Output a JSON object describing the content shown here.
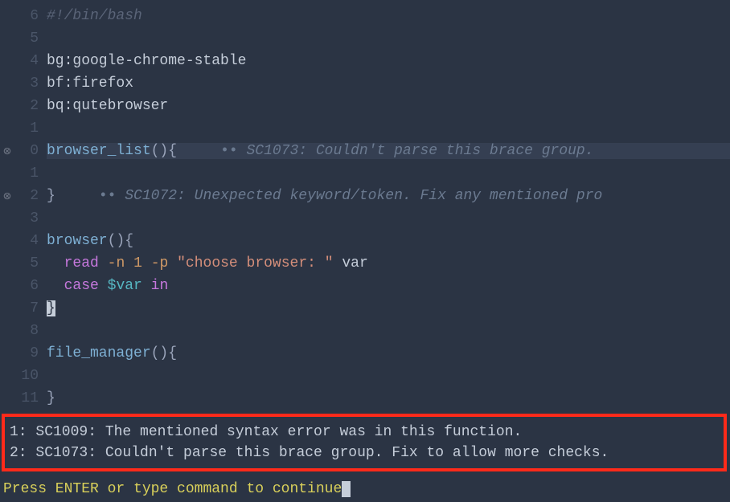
{
  "lines": [
    {
      "rel": "6",
      "sign": "",
      "hl": false,
      "segments": [
        {
          "cls": "comment",
          "text": "#!/bin/bash"
        }
      ]
    },
    {
      "rel": "5",
      "sign": "",
      "hl": false,
      "segments": []
    },
    {
      "rel": "4",
      "sign": "",
      "hl": false,
      "segments": [
        {
          "cls": "plain",
          "text": "bg:google-chrome-stable"
        }
      ]
    },
    {
      "rel": "3",
      "sign": "",
      "hl": false,
      "segments": [
        {
          "cls": "plain",
          "text": "bf:firefox"
        }
      ]
    },
    {
      "rel": "2",
      "sign": "",
      "hl": false,
      "segments": [
        {
          "cls": "plain",
          "text": "bq:qutebrowser"
        }
      ]
    },
    {
      "rel": "1",
      "sign": "",
      "hl": false,
      "segments": []
    },
    {
      "rel": "0",
      "sign": "⊗",
      "hl": true,
      "segments": [
        {
          "cls": "func",
          "text": "browser_list"
        },
        {
          "cls": "paren",
          "text": "()"
        },
        {
          "cls": "brace",
          "text": "{"
        },
        {
          "cls": "plain",
          "text": "     "
        },
        {
          "cls": "lint-dots",
          "text": "•• "
        },
        {
          "cls": "lint-msg",
          "text": "SC1073: Couldn't parse this brace group."
        }
      ]
    },
    {
      "rel": "1",
      "sign": "",
      "hl": false,
      "segments": []
    },
    {
      "rel": "2",
      "sign": "⊗",
      "hl": false,
      "segments": [
        {
          "cls": "brace",
          "text": "}"
        },
        {
          "cls": "plain",
          "text": "     "
        },
        {
          "cls": "lint-dots",
          "text": "•• "
        },
        {
          "cls": "lint-msg",
          "text": "SC1072: Unexpected keyword/token. Fix any mentioned pro"
        }
      ]
    },
    {
      "rel": "3",
      "sign": "",
      "hl": false,
      "segments": []
    },
    {
      "rel": "4",
      "sign": "",
      "hl": false,
      "segments": [
        {
          "cls": "func",
          "text": "browser"
        },
        {
          "cls": "paren",
          "text": "()"
        },
        {
          "cls": "brace",
          "text": "{"
        }
      ]
    },
    {
      "rel": "5",
      "sign": "",
      "hl": false,
      "segments": [
        {
          "cls": "plain",
          "text": "  "
        },
        {
          "cls": "keyword",
          "text": "read"
        },
        {
          "cls": "plain",
          "text": " "
        },
        {
          "cls": "flag",
          "text": "-n"
        },
        {
          "cls": "plain",
          "text": " "
        },
        {
          "cls": "number",
          "text": "1"
        },
        {
          "cls": "plain",
          "text": " "
        },
        {
          "cls": "flag",
          "text": "-p"
        },
        {
          "cls": "plain",
          "text": " "
        },
        {
          "cls": "string",
          "text": "\"choose browser: \""
        },
        {
          "cls": "plain",
          "text": " var"
        }
      ]
    },
    {
      "rel": "6",
      "sign": "",
      "hl": false,
      "segments": [
        {
          "cls": "plain",
          "text": "  "
        },
        {
          "cls": "keyword",
          "text": "case"
        },
        {
          "cls": "plain",
          "text": " "
        },
        {
          "cls": "var",
          "text": "$var"
        },
        {
          "cls": "plain",
          "text": " "
        },
        {
          "cls": "keyword",
          "text": "in"
        }
      ]
    },
    {
      "rel": "7",
      "sign": "",
      "hl": false,
      "segments": [
        {
          "cls": "cursor-block",
          "text": "}"
        }
      ]
    },
    {
      "rel": "8",
      "sign": "",
      "hl": false,
      "segments": []
    },
    {
      "rel": "9",
      "sign": "",
      "hl": false,
      "segments": [
        {
          "cls": "func",
          "text": "file_manager"
        },
        {
          "cls": "paren",
          "text": "()"
        },
        {
          "cls": "brace",
          "text": "{"
        }
      ]
    },
    {
      "rel": "10",
      "sign": "",
      "hl": false,
      "segments": []
    },
    {
      "rel": "11",
      "sign": "",
      "hl": false,
      "segments": [
        {
          "cls": "brace",
          "text": "}"
        }
      ]
    }
  ],
  "errors": [
    {
      "prefix": "1: ",
      "code": "SC1009",
      "msg": ": The mentioned syntax error was in this function."
    },
    {
      "prefix": "2: ",
      "code": "SC1073",
      "msg": ": Couldn't parse this brace group. Fix to allow more checks."
    }
  ],
  "prompt": "Press ENTER or type command to continue"
}
